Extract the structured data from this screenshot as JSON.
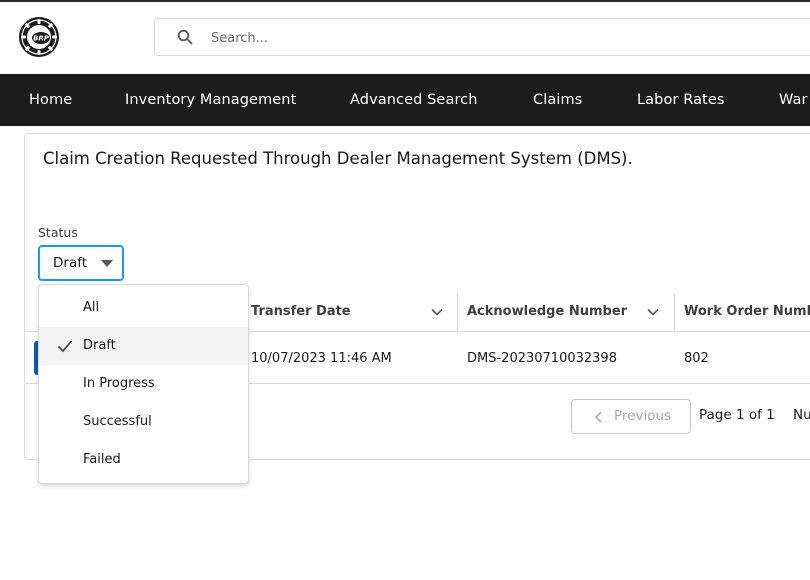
{
  "header": {
    "logo_text": "BRP",
    "search": {
      "placeholder": "Search...",
      "value": ""
    }
  },
  "nav": {
    "items": [
      {
        "label": "Home"
      },
      {
        "label": "Inventory Management"
      },
      {
        "label": "Advanced Search"
      },
      {
        "label": "Claims"
      },
      {
        "label": "Labor Rates"
      },
      {
        "label": "War"
      }
    ]
  },
  "main": {
    "title": "Claim Creation Requested Through Dealer Management System (DMS).",
    "status_filter": {
      "label": "Status",
      "selected": "Draft",
      "options": [
        {
          "label": "All",
          "selected": false
        },
        {
          "label": "Draft",
          "selected": true
        },
        {
          "label": "In Progress",
          "selected": false
        },
        {
          "label": "Successful",
          "selected": false
        },
        {
          "label": "Failed",
          "selected": false
        }
      ]
    },
    "table": {
      "columns": [
        {
          "label": "Transfer Date"
        },
        {
          "label": "Acknowledge Number"
        },
        {
          "label": "Work Order Numb"
        }
      ],
      "rows": [
        {
          "transfer_date": "10/07/2023 11:46 AM",
          "acknowledge_number": "DMS-20230710032398",
          "work_order_number": "802"
        }
      ]
    },
    "pagination": {
      "previous_label": "Previous",
      "page_info": "Page 1 of 1",
      "extra": "Nu"
    }
  },
  "colors": {
    "navbar_bg": "#1c1c1c",
    "focus_blue": "#1b96ff",
    "row_button": "#0b5cab"
  }
}
